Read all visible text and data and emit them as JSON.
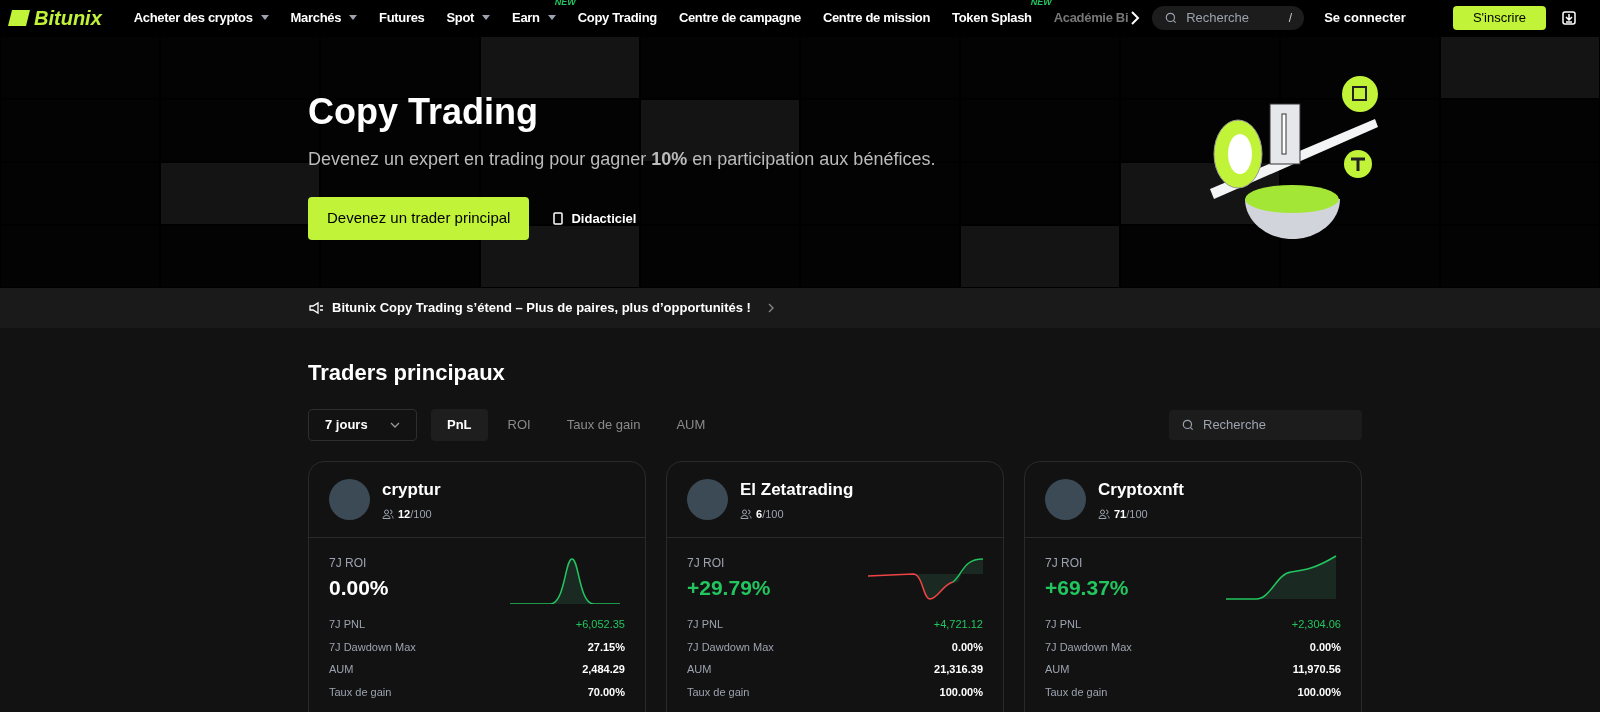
{
  "nav": {
    "logo": "Bitunix",
    "items": [
      {
        "label": "Acheter des cryptos",
        "dropdown": true
      },
      {
        "label": "Marchés",
        "dropdown": true
      },
      {
        "label": "Futures",
        "dropdown": false
      },
      {
        "label": "Spot",
        "dropdown": true
      },
      {
        "label": "Earn",
        "dropdown": true,
        "badge": "NEW"
      },
      {
        "label": "Copy Trading",
        "dropdown": false
      },
      {
        "label": "Centre de campagne",
        "dropdown": false
      },
      {
        "label": "Centre de mission",
        "dropdown": false
      },
      {
        "label": "Token Splash",
        "dropdown": false,
        "badge": "NEW"
      },
      {
        "label": "Académie Bi",
        "dropdown": false
      }
    ],
    "search": {
      "placeholder": "Recherche",
      "shortcut": "/"
    },
    "login": "Se connecter",
    "signup": "S'inscrire"
  },
  "hero": {
    "title": "Copy Trading",
    "subtitle": "Devenez un expert en trading pour gagner **10%** en participation aux bénéfices.",
    "cta": "Devenez un trader principal",
    "tutorial": "Didacticiel"
  },
  "announcement": "Bitunix Copy Trading s’étend – Plus de paires, plus d’opportunités !",
  "section": {
    "title": "Traders principaux",
    "period": "7 jours",
    "tabs": [
      {
        "label": "PnL",
        "selected": true
      },
      {
        "label": "ROI",
        "selected": false
      },
      {
        "label": "Taux de gain",
        "selected": false
      },
      {
        "label": "AUM",
        "selected": false
      }
    ],
    "search_placeholder": "Recherche"
  },
  "traders": [
    {
      "name": "cryptur",
      "followers": "12",
      "capacity": "/100",
      "roi_label": "7J ROI",
      "roi": "0.00%",
      "positive": false,
      "stats": [
        {
          "label": "7J PNL",
          "value": "+6,052.35",
          "kind": "gain"
        },
        {
          "label": "7J Dawdown Max",
          "value": "27.15%",
          "kind": "plain"
        },
        {
          "label": "AUM",
          "value": "2,484.29",
          "kind": "plain"
        },
        {
          "label": "Taux de gain",
          "value": "70.00%",
          "kind": "plain"
        }
      ]
    },
    {
      "name": "El Zetatrading",
      "followers": "6",
      "capacity": "/100",
      "roi_label": "7J ROI",
      "roi": "+29.79%",
      "positive": true,
      "stats": [
        {
          "label": "7J PNL",
          "value": "+4,721.12",
          "kind": "gain"
        },
        {
          "label": "7J Dawdown Max",
          "value": "0.00%",
          "kind": "plain"
        },
        {
          "label": "AUM",
          "value": "21,316.39",
          "kind": "plain"
        },
        {
          "label": "Taux de gain",
          "value": "100.00%",
          "kind": "plain"
        }
      ]
    },
    {
      "name": "Cryptoxnft",
      "followers": "71",
      "capacity": "/100",
      "roi_label": "7J ROI",
      "roi": "+69.37%",
      "positive": true,
      "stats": [
        {
          "label": "7J PNL",
          "value": "+2,304.06",
          "kind": "gain"
        },
        {
          "label": "7J Dawdown Max",
          "value": "0.00%",
          "kind": "plain"
        },
        {
          "label": "AUM",
          "value": "11,970.56",
          "kind": "plain"
        },
        {
          "label": "Taux de gain",
          "value": "100.00%",
          "kind": "plain"
        }
      ]
    }
  ]
}
